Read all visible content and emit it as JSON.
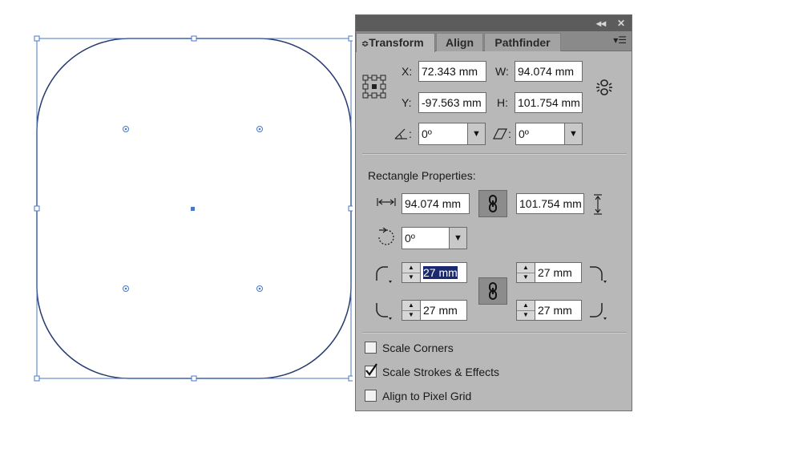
{
  "panel": {
    "title_buttons": {
      "collapse": "◂◂",
      "close": "✕"
    },
    "tabs": [
      {
        "label": "Transform",
        "active": true
      },
      {
        "label": "Align",
        "active": false
      },
      {
        "label": "Pathfinder",
        "active": false
      }
    ],
    "tab_arrow": "≎",
    "menu_icon": "▾☰"
  },
  "transform": {
    "x_label": "X:",
    "x_value": "72.343 mm",
    "w_label": "W:",
    "w_value": "94.074 mm",
    "y_label": "Y:",
    "y_value": "-97.563 mm",
    "h_label": "H:",
    "h_value": "101.754 mm",
    "angle_label": ":",
    "angle_value": "0º",
    "shear_label": ":",
    "shear_value": "0º"
  },
  "rectangle": {
    "heading": "Rectangle Properties:",
    "width_value": "94.074 mm",
    "height_value": "101.754 mm",
    "rotation_value": "0º",
    "corner_tl": "27 mm",
    "corner_tr": "27 mm",
    "corner_bl": "27 mm",
    "corner_br": "27 mm"
  },
  "options": {
    "scale_corners": {
      "label": "Scale Corners",
      "checked": false
    },
    "scale_strokes": {
      "label": "Scale Strokes & Effects",
      "checked": true
    },
    "align_pixel": {
      "label": "Align to Pixel Grid",
      "checked": false
    }
  },
  "colors": {
    "selection": "#4a78c8",
    "shape_stroke": "#283a70",
    "panel_bg": "#b8b8b8",
    "titlebar": "#5c5c5c"
  }
}
